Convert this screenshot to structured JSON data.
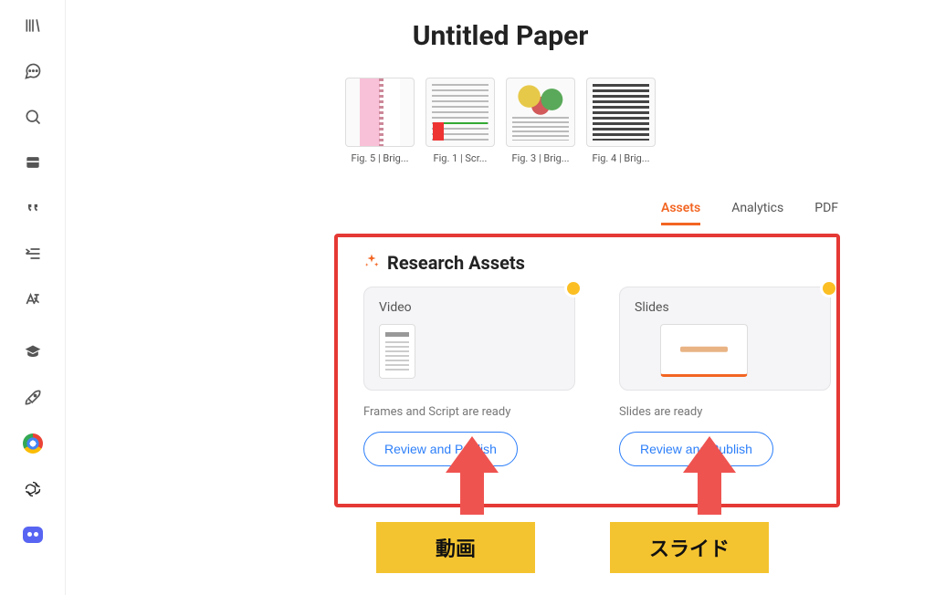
{
  "title": "Untitled Paper",
  "figures": [
    {
      "caption": "Fig. 5 | Brig..."
    },
    {
      "caption": "Fig. 1 | Scr..."
    },
    {
      "caption": "Fig. 3 | Brig..."
    },
    {
      "caption": "Fig. 4 | Brig..."
    }
  ],
  "tabs": {
    "assets": "Assets",
    "analytics": "Analytics",
    "pdf": "PDF"
  },
  "section_heading": "Research Assets",
  "cards": {
    "video": {
      "title": "Video",
      "status": "Frames and Script are ready",
      "cta": "Review and Publish"
    },
    "slides": {
      "title": "Slides",
      "status": "Slides are ready",
      "cta": "Review and Publish"
    }
  },
  "annotations": {
    "video_label": "動画",
    "slides_label": "スライド"
  },
  "colors": {
    "accent": "#f26522",
    "link_blue": "#2d7ff9",
    "annotation_red": "#e53935",
    "annotation_yellow": "#f4c430"
  }
}
